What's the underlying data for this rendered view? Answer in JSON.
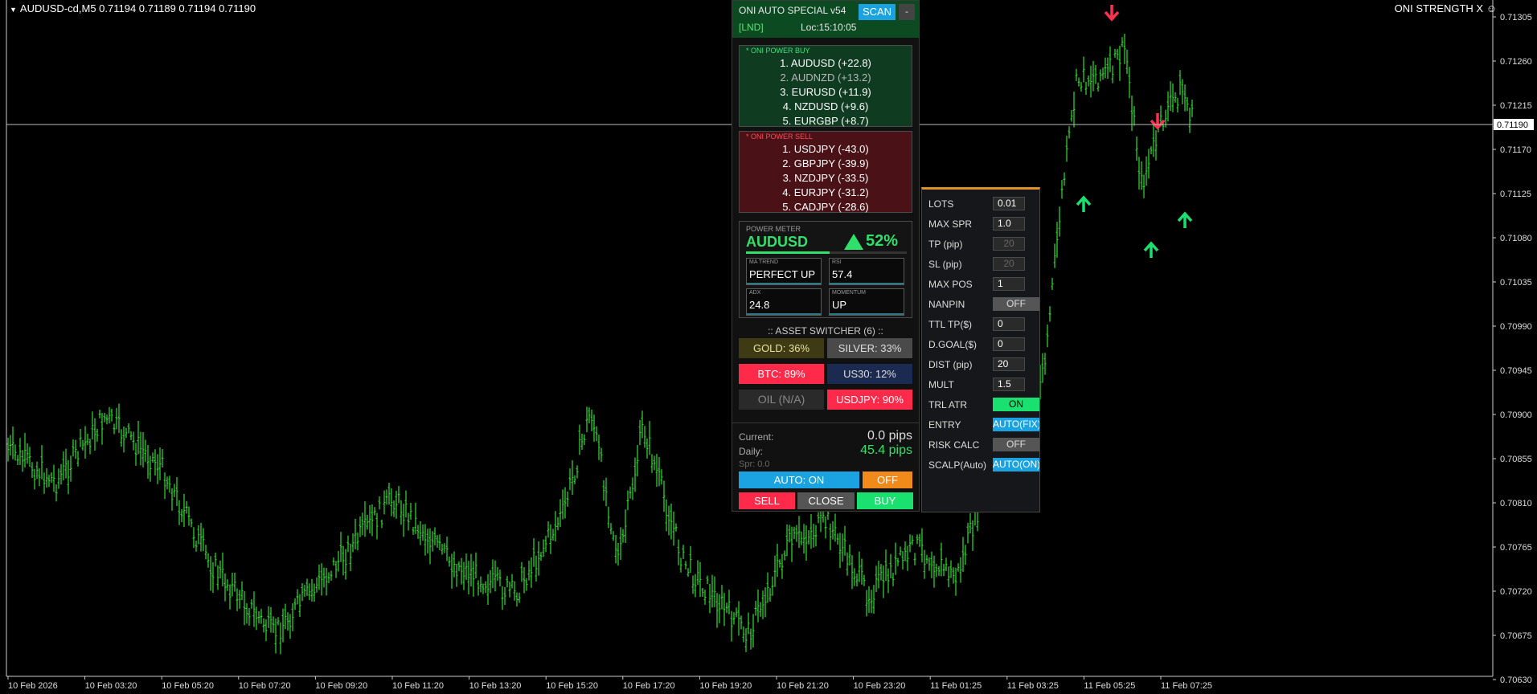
{
  "chart": {
    "symbol_line": "AUDUSD-cd,M5  0.71194 0.71189 0.71194 0.71190",
    "strength_title": "ONI STRENGTH X ☺",
    "current_price_label": "0.71190",
    "bar_color": "#2ee02e",
    "y_ticks": [
      "0.71305",
      "0.71260",
      "0.71215",
      "0.71170",
      "0.71125",
      "0.71080",
      "0.71035",
      "0.70990",
      "0.70945",
      "0.70900",
      "0.70855",
      "0.70810",
      "0.70765",
      "0.70720",
      "0.70675",
      "0.70630"
    ],
    "x_ticks": [
      "10 Feb 2026",
      "10 Feb 03:20",
      "10 Feb 05:20",
      "10 Feb 07:20",
      "10 Feb 09:20",
      "10 Feb 11:20",
      "10 Feb 13:20",
      "10 Feb 15:20",
      "10 Feb 17:20",
      "10 Feb 19:20",
      "10 Feb 21:20",
      "10 Feb 23:20",
      "11 Feb 01:25",
      "11 Feb 03:25",
      "11 Feb 05:25",
      "11 Feb 07:25"
    ]
  },
  "panel": {
    "title": "ONI AUTO SPECIAL v54",
    "scan": "SCAN",
    "minimize": "-",
    "session": "[LND]",
    "local_time": "Loc:15:10:05",
    "buy_header": "* ONI POWER BUY",
    "buy_list": [
      "1. AUDUSD (+22.8)",
      "2. AUDNZD (+13.2)",
      "3. EURUSD (+11.9)",
      "4. NZDUSD (+9.6)",
      "5. EURGBP (+8.7)"
    ],
    "sell_header": "* ONI POWER SELL",
    "sell_list": [
      "1. USDJPY (-43.0)",
      "2. GBPJPY (-39.9)",
      "3. NZDJPY (-33.5)",
      "4. EURJPY (-31.2)",
      "5. CADJPY (-28.6)"
    ],
    "power_meter": {
      "label": "POWER METER",
      "symbol": "AUDUSD",
      "percent": "52%",
      "fill_fraction": 0.52,
      "ma_trend_label": "MA TREND",
      "ma_trend": "PERFECT UP",
      "rsi_label": "RSI",
      "rsi": "57.4",
      "adx_label": "ADX",
      "adx": "24.8",
      "momentum_label": "MOMENTUM",
      "momentum": "UP"
    },
    "asset_switcher": {
      "title": ":: ASSET SWITCHER (6) ::",
      "gold": "GOLD: 36%",
      "silver": "SILVER: 33%",
      "btc": "BTC: 89%",
      "us30": "US30: 12%",
      "oil": "OIL (N/A)",
      "usdjpy": "USDJPY: 90%"
    },
    "stats": {
      "current_label": "Current:",
      "current_value": "0.0 pips",
      "daily_label": "Daily:",
      "daily_value": "45.4 pips",
      "spread": "Spr: 0.0"
    },
    "auto_btn": "AUTO: ON",
    "off_btn": "OFF",
    "sell_btn": "SELL",
    "close_btn": "CLOSE",
    "buy_btn": "BUY"
  },
  "settings": {
    "lots_label": "LOTS",
    "lots": "0.01",
    "max_spr_label": "MAX SPR",
    "max_spr": "1.0",
    "tp_label": "TP (pip)",
    "tp": "20",
    "sl_label": "SL (pip)",
    "sl": "20",
    "max_pos_label": "MAX POS",
    "max_pos": "1",
    "nanpin_label": "NANPIN",
    "nanpin": "OFF",
    "ttl_tp_label": "TTL TP($)",
    "ttl_tp": "0",
    "d_goal_label": "D.GOAL($)",
    "d_goal": "0",
    "dist_label": "DIST (pip)",
    "dist": "20",
    "mult_label": "MULT",
    "mult": "1.5",
    "trl_atr_label": "TRL ATR",
    "trl_atr": "ON",
    "entry_label": "ENTRY",
    "entry": "AUTO(FIX)",
    "risk_calc_label": "RISK CALC",
    "risk_calc": "OFF",
    "scalp_label": "SCALP(Auto)",
    "scalp": "AUTO(ON)"
  }
}
